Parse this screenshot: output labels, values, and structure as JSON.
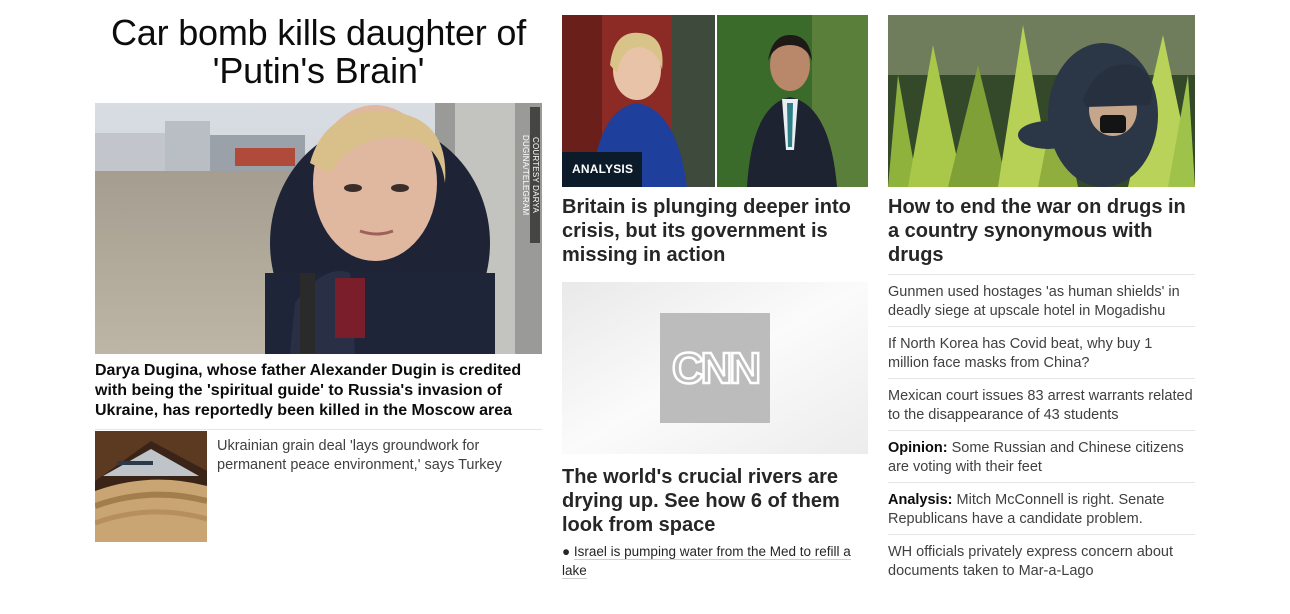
{
  "lead": {
    "headline": "Car bomb kills daughter of 'Putin's Brain'",
    "image_credit": "COURTESY DARYA DUGINA/TELEGRAM",
    "caption": "Darya Dugina, whose father Alexander Dugin is credited with being the 'spiritual guide' to Russia's invasion of Ukraine, has reportedly been killed in the Moscow area"
  },
  "lead_related": {
    "text": "Ukrainian grain deal 'lays groundwork for permanent peace environment,' says Turkey"
  },
  "col2": {
    "story1": {
      "badge": "ANALYSIS",
      "headline": "Britain is plunging deeper into crisis, but its government is missing in action"
    },
    "story2": {
      "logo_text": "CNN",
      "headline": "The world's crucial rivers are drying up. See how 6 of them look from space",
      "bullet": "Israel is pumping water from the Med to refill a lake"
    }
  },
  "col3": {
    "headline": "How to end the war on drugs in a country synonymous with drugs",
    "items": [
      {
        "prefix": "",
        "text": "Gunmen used hostages 'as human shields' in deadly siege at upscale hotel in Mogadishu"
      },
      {
        "prefix": "",
        "text": "If North Korea has Covid beat, why buy 1 million face masks from China?"
      },
      {
        "prefix": "",
        "text": "Mexican court issues 83 arrest warrants related to the disappearance of 43 students"
      },
      {
        "prefix": "Opinion:",
        "text": " Some Russian and Chinese citizens are voting with their feet"
      },
      {
        "prefix": "Analysis:",
        "text": " Mitch McConnell is right. Senate Republicans have a candidate problem."
      },
      {
        "prefix": "",
        "text": "WH officials privately express concern about documents taken to Mar-a-Lago"
      }
    ]
  },
  "colors": {
    "badge_bg": "#0c1b2a",
    "text_primary": "#0c0c0c",
    "text_secondary": "#404040",
    "divider": "#e6e6e6"
  }
}
